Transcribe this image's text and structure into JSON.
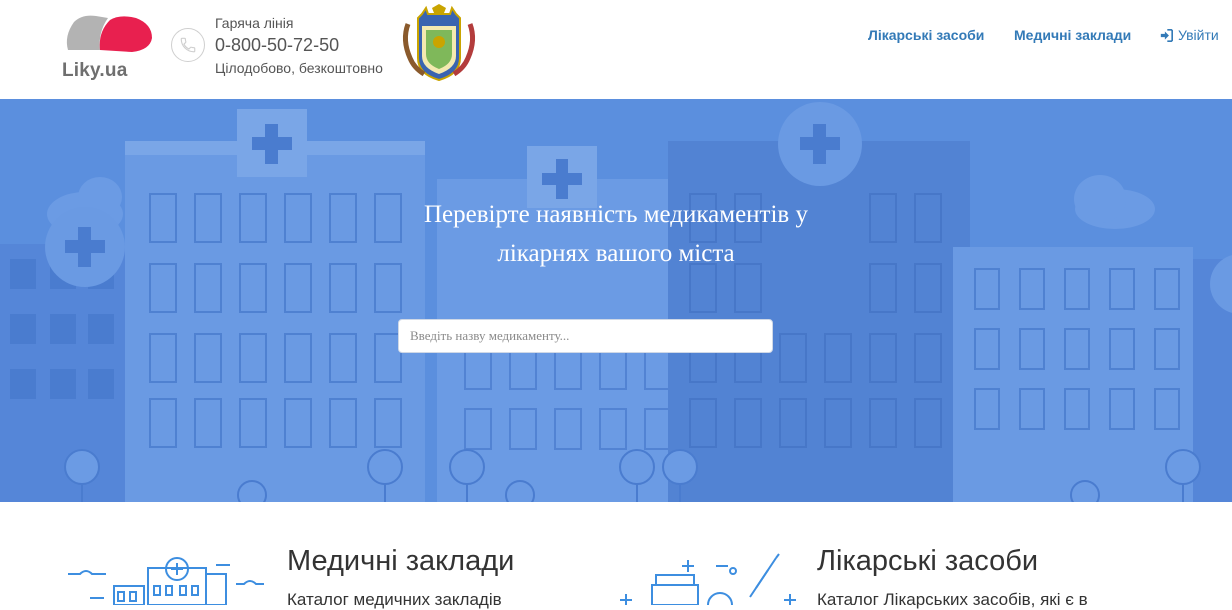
{
  "header": {
    "logo_text": "Liky.ua",
    "hotline_label": "Гаряча лінія",
    "hotline_number": "0-800-50-72-50",
    "hotline_note": "Цілодобово, безкоштовно",
    "nav": {
      "medicines": "Лікарські засоби",
      "clinics": "Медичні заклади",
      "login": "Увійти"
    }
  },
  "hero": {
    "title": "Перевірте наявність медикаментів у лікарнях вашого міста",
    "search_placeholder": "Введіть назву медикаменту..."
  },
  "features": [
    {
      "title": "Медичні заклади",
      "subtitle": "Каталог медичних закладів"
    },
    {
      "title": "Лікарські засоби",
      "subtitle": "Каталог Лікарських засобів, які є в"
    }
  ],
  "colors": {
    "link": "#337ab7",
    "hero_bg": "#5b8fde",
    "logo_red": "#e8204f",
    "logo_grey": "#b3b3b3",
    "icon_blue": "#3d8ee0"
  }
}
